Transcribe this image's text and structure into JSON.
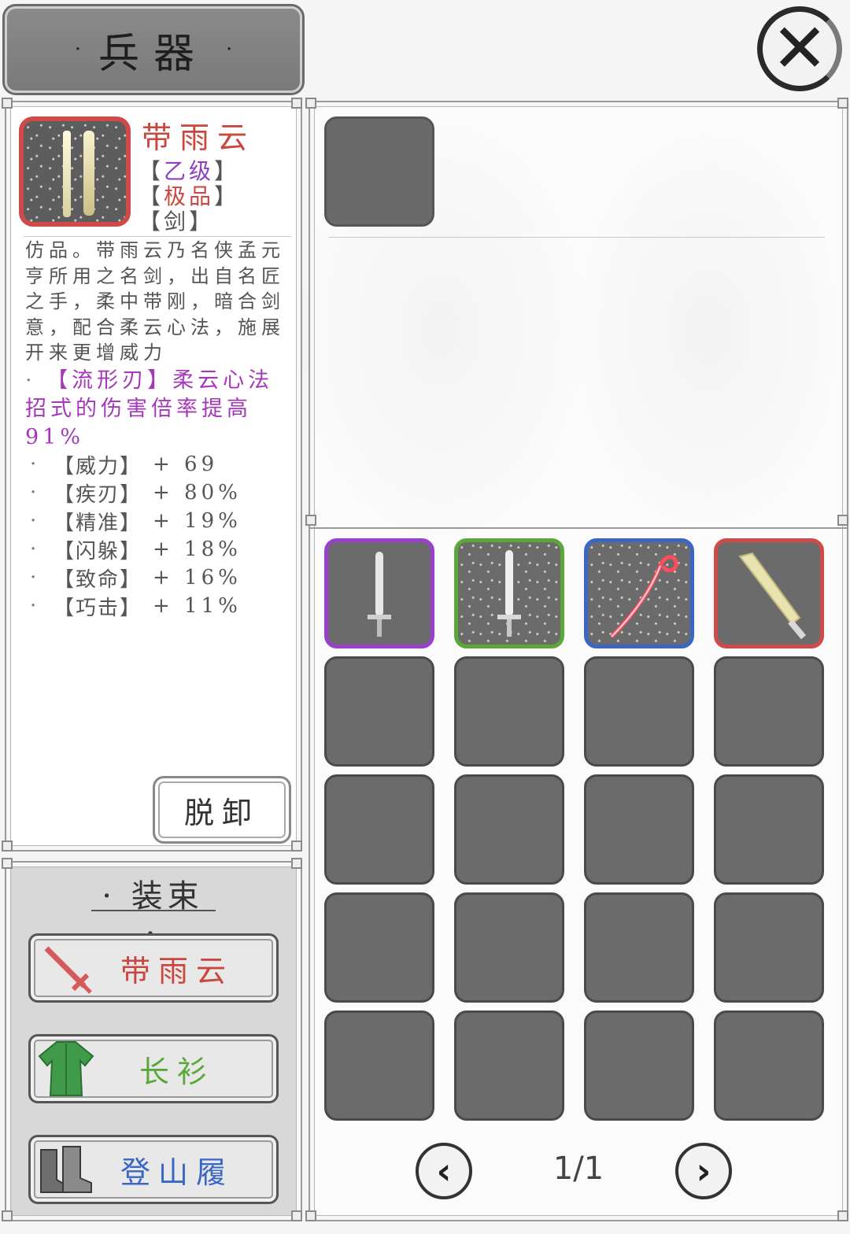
{
  "header": {
    "title": "兵器"
  },
  "close": {
    "icon": "close-icon",
    "glyph": "✕"
  },
  "item": {
    "name": "带雨云",
    "grade_label": "乙级",
    "quality_label": "极品",
    "type_label": "剑",
    "rarity_color": "#d04a4a",
    "description": "仿品。带雨云乃名侠孟元亨所用之名剑，出自名匠之手，柔中带刚，暗合剑意，配合柔云心法，施展开来更增威力",
    "skill_bullet": "·",
    "skill_text": "【流形刃】柔云心法招式的伤害倍率提高91%",
    "stats": [
      {
        "bullet": "·",
        "name": "【威力】",
        "value": "+ 69"
      },
      {
        "bullet": "·",
        "name": "【疾刃】",
        "value": "+ 80%"
      },
      {
        "bullet": "·",
        "name": "【精准】",
        "value": "+ 19%"
      },
      {
        "bullet": "·",
        "name": "【闪躲】",
        "value": "+ 18%"
      },
      {
        "bullet": "·",
        "name": "【致命】",
        "value": "+ 16%"
      },
      {
        "bullet": "·",
        "name": "【巧击】",
        "value": "+ 11%"
      }
    ],
    "unequip_label": "脱卸"
  },
  "outfit": {
    "title": "装束",
    "slots": [
      {
        "label": "带雨云",
        "color": "#c9473f",
        "icon": "sword-icon"
      },
      {
        "label": "长衫",
        "color": "#5aa83a",
        "icon": "robe-icon"
      },
      {
        "label": "登山履",
        "color": "#3a66c4",
        "icon": "boots-icon"
      }
    ]
  },
  "inventory": {
    "items": [
      {
        "rarity": "purple",
        "icon": "sword-icon"
      },
      {
        "rarity": "green",
        "icon": "sword-icon"
      },
      {
        "rarity": "blue",
        "icon": "whip-sword-icon"
      },
      {
        "rarity": "red",
        "icon": "broadsword-icon"
      }
    ],
    "empty_slots": 16
  },
  "pager": {
    "page": "1/1",
    "prev_icon": "chevron-left-icon",
    "next_icon": "chevron-right-icon"
  }
}
